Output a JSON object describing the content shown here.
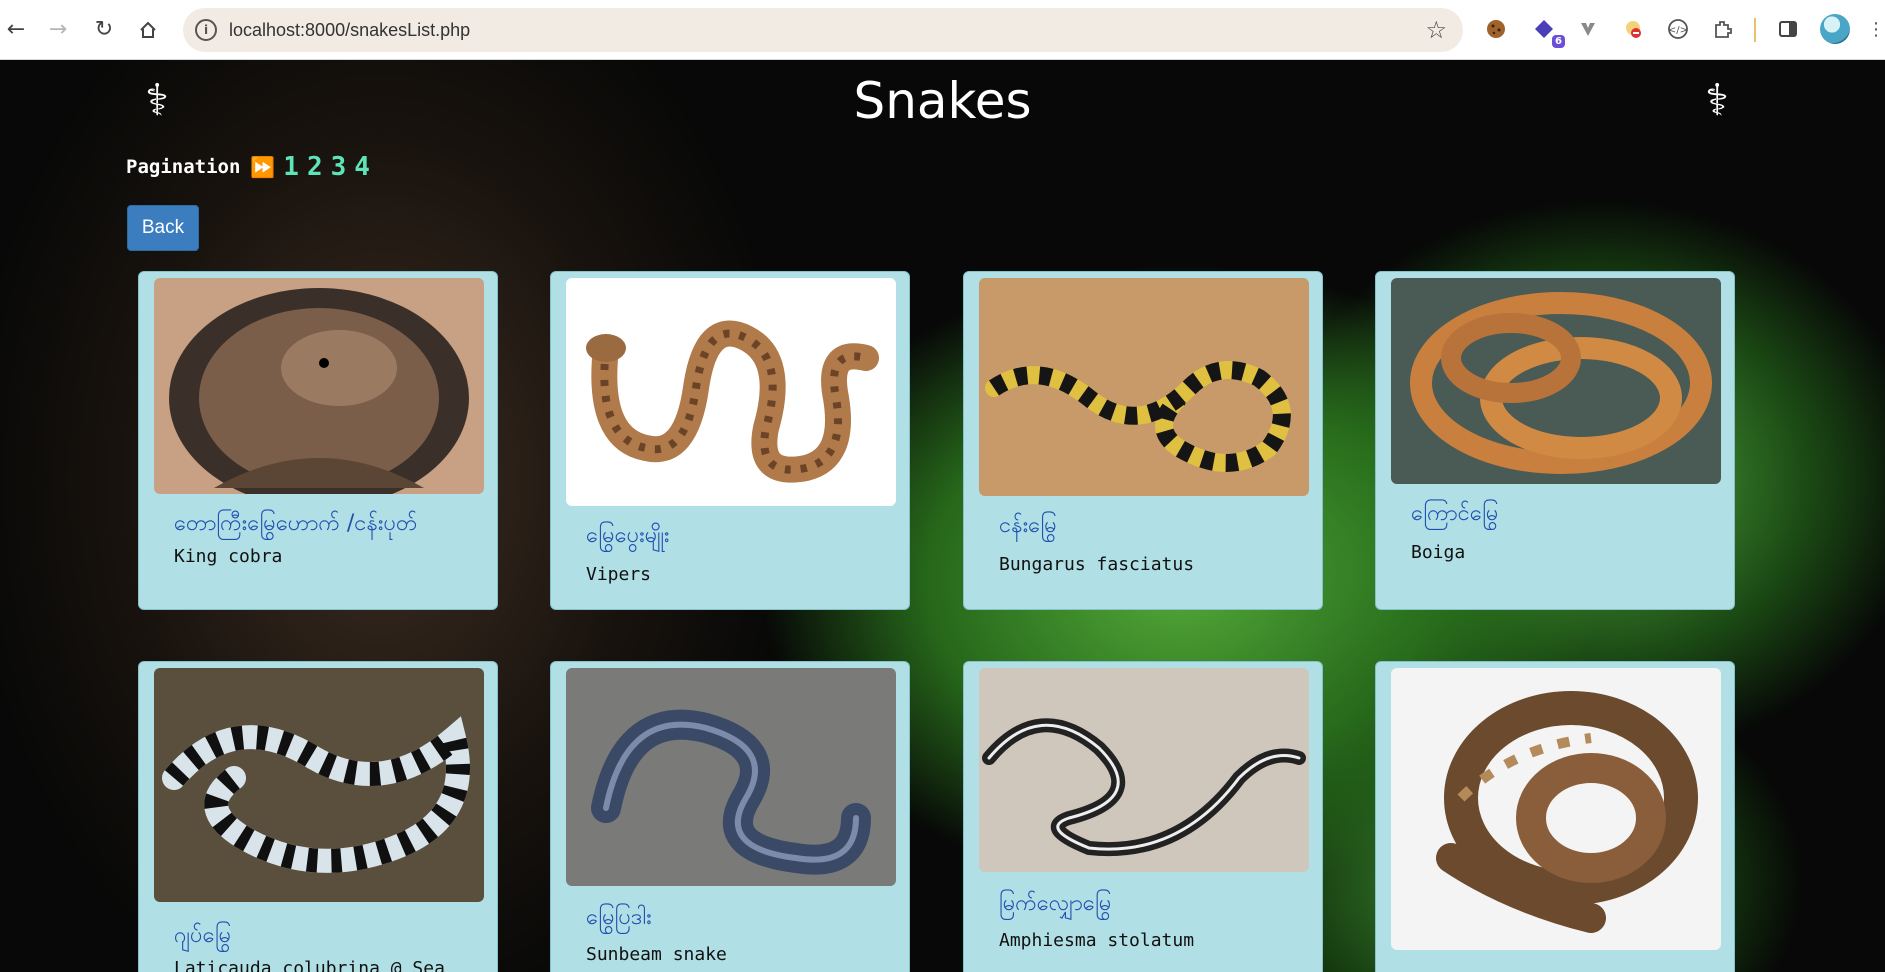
{
  "browser": {
    "url": "localhost:8000/snakesList.php",
    "extensions": [
      "cookie-icon",
      "puzzle-badge-icon",
      "vee-icon",
      "shield-icon",
      "code-icon",
      "extensions-icon"
    ],
    "extension_badge": "6"
  },
  "page": {
    "title": "Snakes",
    "pagination_label": "Pagination",
    "pages": [
      "1",
      "2",
      "3",
      "4"
    ],
    "back_label": "Back"
  },
  "snakes": [
    {
      "mm": "တောကြီးမြွေဟောက် /ငန်းပုတ်",
      "en": "King cobra",
      "image": "king-cobra"
    },
    {
      "mm": "မြွေပွေးမျိုး",
      "en": "Vipers",
      "image": "viper"
    },
    {
      "mm": "ငန်းမြွေ",
      "en": "Bungarus fasciatus",
      "image": "banded-krait"
    },
    {
      "mm": "ကြောင်မြွေ",
      "en": "Boiga",
      "image": "boiga"
    },
    {
      "mm": "ဂျပ်မြွေ",
      "en": "Laticauda colubrina @ Sea",
      "image": "sea-krait"
    },
    {
      "mm": "မြွေပြဒါး",
      "en": "Sunbeam snake",
      "image": "sunbeam"
    },
    {
      "mm": "မြက်လျှောမြွေ",
      "en": "Amphiesma stolatum",
      "image": "keelback"
    },
    {
      "mm": "",
      "en": "",
      "image": "python"
    }
  ],
  "colors": {
    "card_bg": "#b0dfe5",
    "mm_text": "#1f4fb0",
    "page_link": "#5fe3b8",
    "back_button": "#3b7dbf"
  }
}
